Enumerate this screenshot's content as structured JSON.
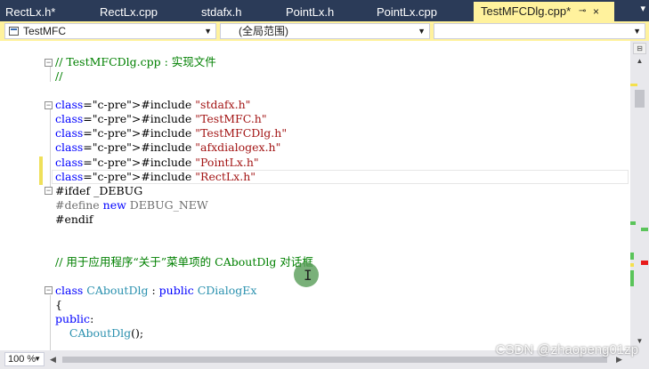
{
  "tabs": [
    {
      "label": "RectLx.h*"
    },
    {
      "label": "RectLx.cpp"
    },
    {
      "label": "stdafx.h"
    },
    {
      "label": "PointLx.h"
    },
    {
      "label": "PointLx.cpp"
    },
    {
      "label": "TestMFCDlg.cpp*",
      "active": true
    }
  ],
  "tab_pin_icon": "pin-icon",
  "tab_close_glyph": "×",
  "tab_overflow_glyph": "▾",
  "navbar": {
    "project_combo": "TestMFC",
    "scope_combo": "(全局范围)",
    "member_combo": ""
  },
  "code": {
    "lines": [
      "// TestMFCDlg.cpp : 实现文件",
      "//",
      "",
      "#include \"stdafx.h\"",
      "#include \"TestMFC.h\"",
      "#include \"TestMFCDlg.h\"",
      "#include \"afxdialogex.h\"",
      "#include \"PointLx.h\"",
      "#include \"RectLx.h\"",
      "#ifdef _DEBUG",
      "#define new DEBUG_NEW",
      "#endif",
      "",
      "",
      "// 用于应用程序“关于”菜单项的 CAboutDlg 对话框",
      "",
      "class CAboutDlg : public CDialogEx",
      "{",
      "public:",
      "    CAboutDlg();"
    ]
  },
  "zoom": "100 %",
  "watermark": "CSDN @zhaopeng01zp",
  "colors": {
    "tab_active_bg": "#fff29d",
    "tab_strip_bg": "#2b3b58",
    "comment": "#008000",
    "keyword": "#0000ff",
    "string": "#a31515",
    "class_name": "#2b91af",
    "change_bar": "#efe05a"
  }
}
